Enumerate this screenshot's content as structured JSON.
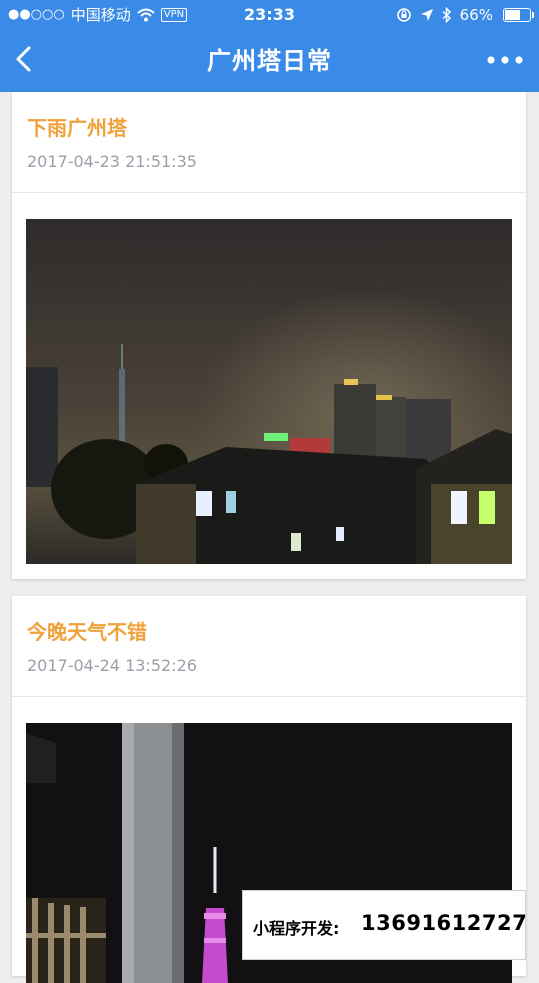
{
  "status_bar": {
    "signal": "●●○○○",
    "carrier": "中国移动",
    "vpn": "VPN",
    "time": "23:33",
    "battery": "66%",
    "battery_level": 0.66
  },
  "nav": {
    "title": "广州塔日常",
    "back_icon": "chevron-left-icon",
    "more_icon": "more-horizontal-icon"
  },
  "colors": {
    "primary": "#3a8ae8",
    "title_orange": "#f0a23a",
    "date_gray": "#9aa0a8"
  },
  "posts": [
    {
      "title": "下雨广州塔",
      "date": "2017-04-23 21:51:35"
    },
    {
      "title": "今晚天气不错",
      "date": "2017-04-24 13:52:26"
    }
  ],
  "banner": {
    "label": "小程序开发:",
    "phone": "13691612727"
  }
}
